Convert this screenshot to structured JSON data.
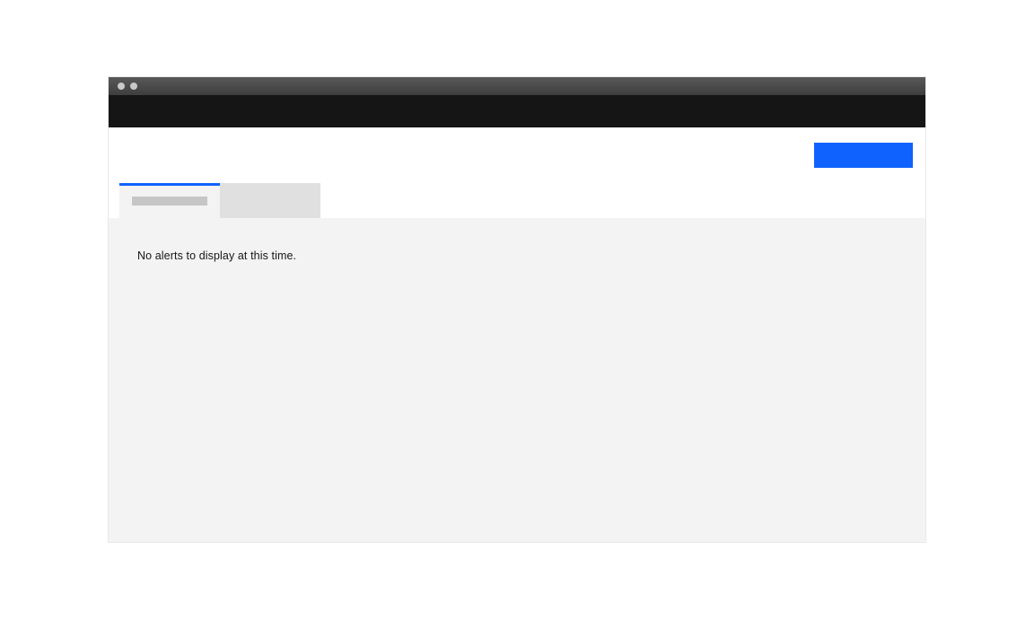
{
  "tabs": [
    {
      "label": "",
      "active": true
    },
    {
      "label": "",
      "active": false
    }
  ],
  "primary_action_label": "",
  "content": {
    "empty_message": "No alerts to display at this time."
  }
}
